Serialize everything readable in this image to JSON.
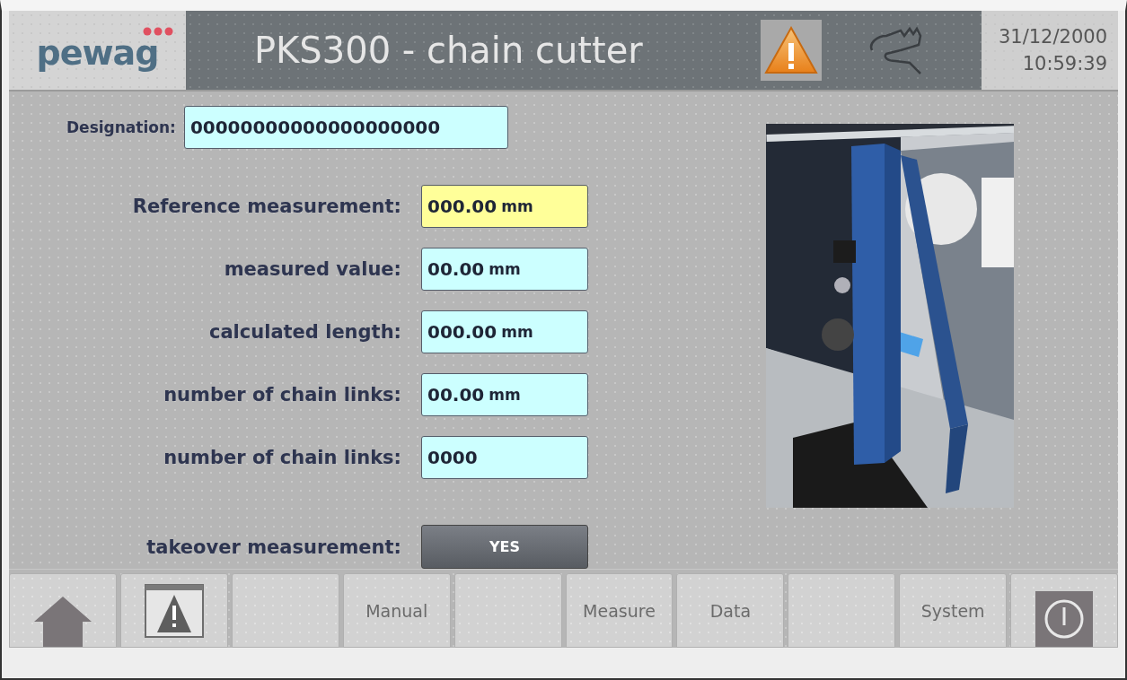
{
  "header": {
    "logo": "pewag",
    "title": "PKS300 - chain cutter",
    "date": "31/12/2000",
    "time": "10:59:39"
  },
  "designation": {
    "label": "Designation:",
    "value": "00000000000000000000"
  },
  "fields": [
    {
      "label": "Reference measurement:",
      "value": "000.00",
      "unit": "mm",
      "highlighted": true
    },
    {
      "label": "measured value:",
      "value": "00.00",
      "unit": "mm",
      "highlighted": false
    },
    {
      "label": "calculated length:",
      "value": "000.00",
      "unit": "mm",
      "highlighted": false
    },
    {
      "label": "number of chain links:",
      "value": "00.00",
      "unit": "mm",
      "highlighted": false
    },
    {
      "label": "number of chain links:",
      "value": "0000",
      "highlighted": false
    }
  ],
  "takeover": {
    "label": "takeover measurement:",
    "button": "YES"
  },
  "nav": [
    {
      "kind": "home"
    },
    {
      "kind": "alarm"
    },
    {
      "kind": "blank"
    },
    {
      "kind": "text",
      "label": "Manual"
    },
    {
      "kind": "blank"
    },
    {
      "kind": "text",
      "label": "Measure"
    },
    {
      "kind": "text",
      "label": "Data"
    },
    {
      "kind": "blank"
    },
    {
      "kind": "text",
      "label": "System"
    },
    {
      "kind": "power"
    }
  ]
}
